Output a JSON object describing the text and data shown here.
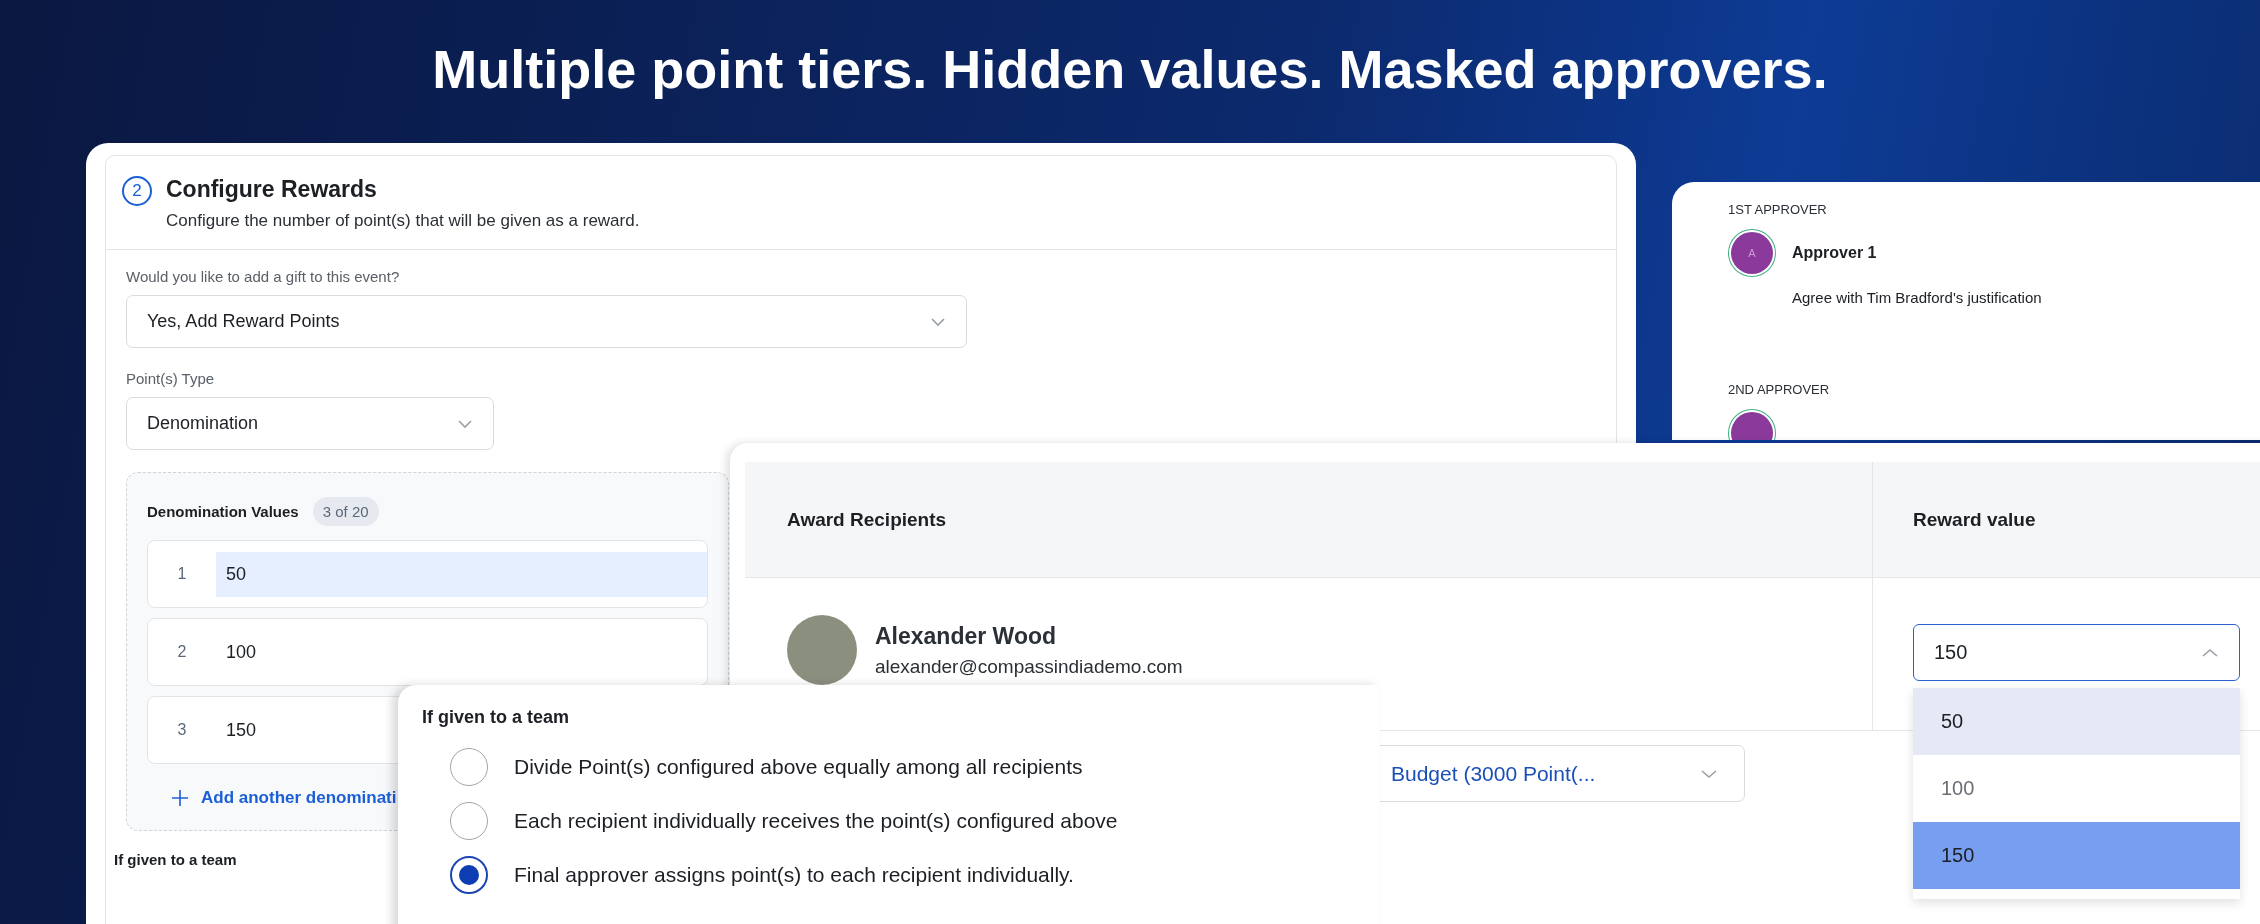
{
  "headline": "Multiple point tiers. Hidden values. Masked approvers.",
  "config_panel": {
    "step": "2",
    "title": "Configure Rewards",
    "subtitle": "Configure the number of point(s) that will be given as a reward.",
    "gift_question": {
      "label": "Would you like to add a gift to this event?",
      "value": "Yes, Add Reward Points"
    },
    "points_type": {
      "label": "Point(s) Type",
      "value": "Denomination"
    },
    "denominations": {
      "title": "Denomination Values",
      "count_badge": "3 of 20",
      "rows": [
        {
          "index": "1",
          "value": "50",
          "selected": true
        },
        {
          "index": "2",
          "value": "100",
          "selected": false
        },
        {
          "index": "3",
          "value": "150",
          "selected": false
        }
      ],
      "add_link": "Add another denominati"
    },
    "team_label": "If given to a team"
  },
  "approvers": [
    {
      "heading": "1ST APPROVER",
      "initial": "A",
      "name": "Approver 1",
      "comment": "Agree with Tim Bradford's justification"
    },
    {
      "heading": "2ND APPROVER"
    }
  ],
  "award_table": {
    "columns": [
      "Award Recipients",
      "Reward value"
    ],
    "rows": [
      {
        "name": "Alexander Wood",
        "email": "alexander@compassindiademo.com",
        "reward_value": "150"
      }
    ],
    "reward_options": [
      {
        "label": "50",
        "highlighted": true,
        "selected": false
      },
      {
        "label": "100",
        "highlighted": false,
        "selected": false
      },
      {
        "label": "150",
        "highlighted": false,
        "selected": true
      }
    ],
    "budget_select": "Budget (3000 Point(..."
  },
  "team_popup": {
    "title": "If given to a team",
    "options": [
      {
        "label": "Divide Point(s) configured above equally among all recipients",
        "selected": false
      },
      {
        "label": "Each recipient individually receives the point(s) configured above",
        "selected": false
      },
      {
        "label": "Final approver assigns point(s) to each recipient individually.",
        "selected": true
      }
    ]
  }
}
